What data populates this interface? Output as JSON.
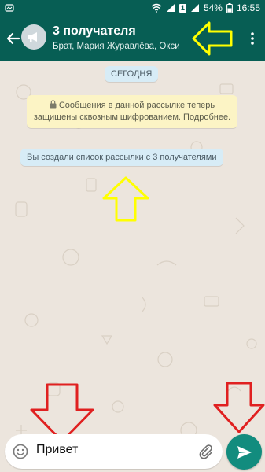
{
  "status_bar": {
    "battery": "54%",
    "time": "16:55",
    "sim_badge": "1"
  },
  "app_bar": {
    "title": "3 получателя",
    "subtitle": "Брат, Мария Журавлёва, Окси",
    "color": "#075e54"
  },
  "chat": {
    "date_label": "СЕГОДНЯ",
    "encryption_notice": "Сообщения в данной рассылке теперь защищены сквозным шифрованием. Подробнее.",
    "info_message": "Вы создали список рассылки с 3 получателями"
  },
  "composer": {
    "value": "Привет",
    "emoji_icon": "emoji-icon",
    "attach_icon": "paperclip-icon",
    "send_icon": "send-icon",
    "send_color": "#128c7e"
  },
  "annotations": {
    "arrow_color_yellow": "#ffff00",
    "arrow_color_red": "#e02020"
  }
}
